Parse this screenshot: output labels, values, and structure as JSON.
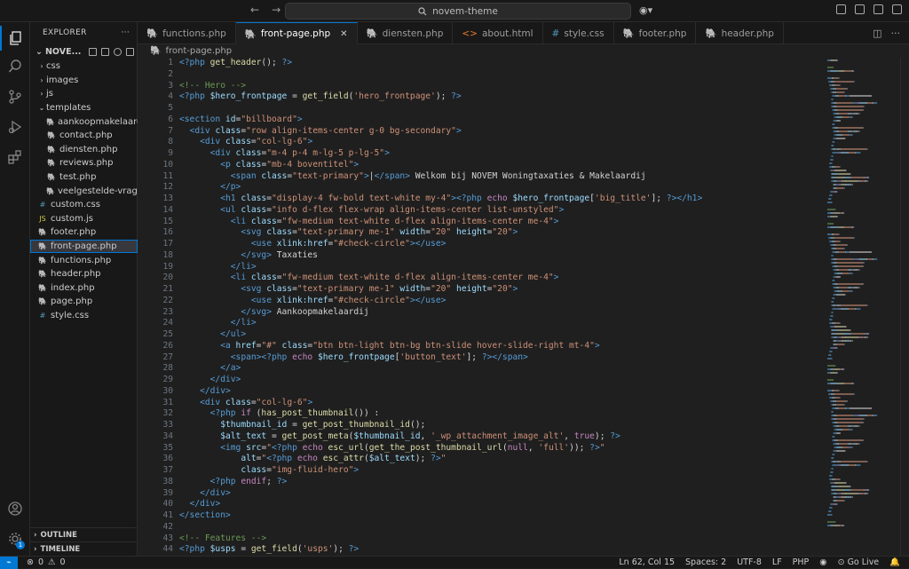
{
  "titlebar": {
    "search": "novem-theme",
    "back": "←",
    "forward": "→"
  },
  "explorer": {
    "title": "EXPLORER",
    "project": "NOVE...",
    "items": [
      {
        "label": "css",
        "type": "folder",
        "depth": 1,
        "open": false
      },
      {
        "label": "images",
        "type": "folder",
        "depth": 1,
        "open": false
      },
      {
        "label": "js",
        "type": "folder",
        "depth": 1,
        "open": false
      },
      {
        "label": "templates",
        "type": "folder",
        "depth": 1,
        "open": true
      },
      {
        "label": "aankoopmakelaard...",
        "type": "php",
        "depth": 2
      },
      {
        "label": "contact.php",
        "type": "php",
        "depth": 2
      },
      {
        "label": "diensten.php",
        "type": "php",
        "depth": 2
      },
      {
        "label": "reviews.php",
        "type": "php",
        "depth": 2
      },
      {
        "label": "test.php",
        "type": "php",
        "depth": 2
      },
      {
        "label": "veelgestelde-vrag...",
        "type": "php",
        "depth": 2
      },
      {
        "label": "custom.css",
        "type": "css",
        "depth": 1
      },
      {
        "label": "custom.js",
        "type": "js",
        "depth": 1
      },
      {
        "label": "footer.php",
        "type": "php",
        "depth": 1
      },
      {
        "label": "front-page.php",
        "type": "php",
        "depth": 1,
        "selected": true
      },
      {
        "label": "functions.php",
        "type": "php",
        "depth": 1
      },
      {
        "label": "header.php",
        "type": "php",
        "depth": 1
      },
      {
        "label": "index.php",
        "type": "php",
        "depth": 1
      },
      {
        "label": "page.php",
        "type": "php",
        "depth": 1
      },
      {
        "label": "style.css",
        "type": "css",
        "depth": 1
      }
    ],
    "outline": "OUTLINE",
    "timeline": "TIMELINE"
  },
  "tabs": [
    {
      "label": "functions.php",
      "type": "php"
    },
    {
      "label": "front-page.php",
      "type": "php",
      "active": true
    },
    {
      "label": "diensten.php",
      "type": "php"
    },
    {
      "label": "about.html",
      "type": "html"
    },
    {
      "label": "style.css",
      "type": "css"
    },
    {
      "label": "footer.php",
      "type": "php"
    },
    {
      "label": "header.php",
      "type": "php"
    }
  ],
  "breadcrumb": "front-page.php",
  "code": [
    [
      [
        "t",
        "<?php "
      ],
      [
        "f",
        "get_header"
      ],
      [
        "p",
        "(); "
      ],
      [
        "t",
        "?>"
      ]
    ],
    [],
    [
      [
        "c",
        "<!-- Hero -->"
      ]
    ],
    [
      [
        "t",
        "<?php "
      ],
      [
        "v",
        "$hero_frontpage"
      ],
      [
        "p",
        " = "
      ],
      [
        "f",
        "get_field"
      ],
      [
        "p",
        "("
      ],
      [
        "s",
        "'hero_frontpage'"
      ],
      [
        "p",
        "); "
      ],
      [
        "t",
        "?>"
      ]
    ],
    [],
    [
      [
        "t",
        "<section "
      ],
      [
        "a",
        "id"
      ],
      [
        "p",
        "="
      ],
      [
        "s",
        "\"billboard\""
      ],
      [
        "t",
        ">"
      ]
    ],
    [
      [
        "p",
        "  "
      ],
      [
        "t",
        "<div "
      ],
      [
        "a",
        "class"
      ],
      [
        "p",
        "="
      ],
      [
        "s",
        "\"row align-items-center g-0 bg-secondary\""
      ],
      [
        "t",
        ">"
      ]
    ],
    [
      [
        "p",
        "    "
      ],
      [
        "t",
        "<div "
      ],
      [
        "a",
        "class"
      ],
      [
        "p",
        "="
      ],
      [
        "s",
        "\"col-lg-6\""
      ],
      [
        "t",
        ">"
      ]
    ],
    [
      [
        "p",
        "      "
      ],
      [
        "t",
        "<div "
      ],
      [
        "a",
        "class"
      ],
      [
        "p",
        "="
      ],
      [
        "s",
        "\"m-4 p-4 m-lg-5 p-lg-5\""
      ],
      [
        "t",
        ">"
      ]
    ],
    [
      [
        "p",
        "        "
      ],
      [
        "t",
        "<p "
      ],
      [
        "a",
        "class"
      ],
      [
        "p",
        "="
      ],
      [
        "s",
        "\"mb-4 boventitel\""
      ],
      [
        "t",
        ">"
      ]
    ],
    [
      [
        "p",
        "          "
      ],
      [
        "t",
        "<span "
      ],
      [
        "a",
        "class"
      ],
      [
        "p",
        "="
      ],
      [
        "s",
        "\"text-primary\""
      ],
      [
        "t",
        ">"
      ],
      [
        "p",
        "|"
      ],
      [
        "t",
        "</span>"
      ],
      [
        "p",
        " Welkom bij NOVEM Woningtaxaties & Makelaardij"
      ]
    ],
    [
      [
        "p",
        "        "
      ],
      [
        "t",
        "</p>"
      ]
    ],
    [
      [
        "p",
        "        "
      ],
      [
        "t",
        "<h1 "
      ],
      [
        "a",
        "class"
      ],
      [
        "p",
        "="
      ],
      [
        "s",
        "\"display-4 fw-bold text-white my-4\""
      ],
      [
        "t",
        ">"
      ],
      [
        "t",
        "<?php "
      ],
      [
        "k",
        "echo "
      ],
      [
        "v",
        "$hero_frontpage"
      ],
      [
        "p",
        "["
      ],
      [
        "s",
        "'big_title'"
      ],
      [
        "p",
        "]; "
      ],
      [
        "t",
        "?>"
      ],
      [
        "t",
        "</h1>"
      ]
    ],
    [
      [
        "p",
        "        "
      ],
      [
        "t",
        "<ul "
      ],
      [
        "a",
        "class"
      ],
      [
        "p",
        "="
      ],
      [
        "s",
        "\"info d-flex flex-wrap align-items-center list-unstyled\""
      ],
      [
        "t",
        ">"
      ]
    ],
    [
      [
        "p",
        "          "
      ],
      [
        "t",
        "<li "
      ],
      [
        "a",
        "class"
      ],
      [
        "p",
        "="
      ],
      [
        "s",
        "\"fw-medium text-white d-flex align-items-center me-4\""
      ],
      [
        "t",
        ">"
      ]
    ],
    [
      [
        "p",
        "            "
      ],
      [
        "t",
        "<svg "
      ],
      [
        "a",
        "class"
      ],
      [
        "p",
        "="
      ],
      [
        "s",
        "\"text-primary me-1\""
      ],
      [
        "a",
        " width"
      ],
      [
        "p",
        "="
      ],
      [
        "s",
        "\"20\""
      ],
      [
        "a",
        " height"
      ],
      [
        "p",
        "="
      ],
      [
        "s",
        "\"20\""
      ],
      [
        "t",
        ">"
      ]
    ],
    [
      [
        "p",
        "              "
      ],
      [
        "t",
        "<use "
      ],
      [
        "a",
        "xlink:href"
      ],
      [
        "p",
        "="
      ],
      [
        "s",
        "\"#check-circle\""
      ],
      [
        "t",
        "></use>"
      ]
    ],
    [
      [
        "p",
        "            "
      ],
      [
        "t",
        "</svg>"
      ],
      [
        "p",
        " Taxaties"
      ]
    ],
    [
      [
        "p",
        "          "
      ],
      [
        "t",
        "</li>"
      ]
    ],
    [
      [
        "p",
        "          "
      ],
      [
        "t",
        "<li "
      ],
      [
        "a",
        "class"
      ],
      [
        "p",
        "="
      ],
      [
        "s",
        "\"fw-medium text-white d-flex align-items-center me-4\""
      ],
      [
        "t",
        ">"
      ]
    ],
    [
      [
        "p",
        "            "
      ],
      [
        "t",
        "<svg "
      ],
      [
        "a",
        "class"
      ],
      [
        "p",
        "="
      ],
      [
        "s",
        "\"text-primary me-1\""
      ],
      [
        "a",
        " width"
      ],
      [
        "p",
        "="
      ],
      [
        "s",
        "\"20\""
      ],
      [
        "a",
        " height"
      ],
      [
        "p",
        "="
      ],
      [
        "s",
        "\"20\""
      ],
      [
        "t",
        ">"
      ]
    ],
    [
      [
        "p",
        "              "
      ],
      [
        "t",
        "<use "
      ],
      [
        "a",
        "xlink:href"
      ],
      [
        "p",
        "="
      ],
      [
        "s",
        "\"#check-circle\""
      ],
      [
        "t",
        "></use>"
      ]
    ],
    [
      [
        "p",
        "            "
      ],
      [
        "t",
        "</svg>"
      ],
      [
        "p",
        " Aankoopmakelaardij"
      ]
    ],
    [
      [
        "p",
        "          "
      ],
      [
        "t",
        "</li>"
      ]
    ],
    [
      [
        "p",
        "        "
      ],
      [
        "t",
        "</ul>"
      ]
    ],
    [
      [
        "p",
        "        "
      ],
      [
        "t",
        "<a "
      ],
      [
        "a",
        "href"
      ],
      [
        "p",
        "="
      ],
      [
        "s",
        "\"#\""
      ],
      [
        "a",
        " class"
      ],
      [
        "p",
        "="
      ],
      [
        "s",
        "\"btn btn-light btn-bg btn-slide hover-slide-right mt-4\""
      ],
      [
        "t",
        ">"
      ]
    ],
    [
      [
        "p",
        "          "
      ],
      [
        "t",
        "<span>"
      ],
      [
        "t",
        "<?php "
      ],
      [
        "k",
        "echo "
      ],
      [
        "v",
        "$hero_frontpage"
      ],
      [
        "p",
        "["
      ],
      [
        "s",
        "'button_text'"
      ],
      [
        "p",
        "]; "
      ],
      [
        "t",
        "?>"
      ],
      [
        "t",
        "</span>"
      ]
    ],
    [
      [
        "p",
        "        "
      ],
      [
        "t",
        "</a>"
      ]
    ],
    [
      [
        "p",
        "      "
      ],
      [
        "t",
        "</div>"
      ]
    ],
    [
      [
        "p",
        "    "
      ],
      [
        "t",
        "</div>"
      ]
    ],
    [
      [
        "p",
        "    "
      ],
      [
        "t",
        "<div "
      ],
      [
        "a",
        "class"
      ],
      [
        "p",
        "="
      ],
      [
        "s",
        "\"col-lg-6\""
      ],
      [
        "t",
        ">"
      ]
    ],
    [
      [
        "p",
        "      "
      ],
      [
        "t",
        "<?php "
      ],
      [
        "k",
        "if "
      ],
      [
        "p",
        "("
      ],
      [
        "f",
        "has_post_thumbnail"
      ],
      [
        "p",
        "()) :"
      ]
    ],
    [
      [
        "p",
        "        "
      ],
      [
        "v",
        "$thumbnail_id"
      ],
      [
        "p",
        " = "
      ],
      [
        "f",
        "get_post_thumbnail_id"
      ],
      [
        "p",
        "();"
      ]
    ],
    [
      [
        "p",
        "        "
      ],
      [
        "v",
        "$alt_text"
      ],
      [
        "p",
        " = "
      ],
      [
        "f",
        "get_post_meta"
      ],
      [
        "p",
        "("
      ],
      [
        "v",
        "$thumbnail_id"
      ],
      [
        "p",
        ", "
      ],
      [
        "s",
        "'_wp_attachment_image_alt'"
      ],
      [
        "p",
        ", "
      ],
      [
        "k",
        "true"
      ],
      [
        "p",
        "); "
      ],
      [
        "t",
        "?>"
      ]
    ],
    [
      [
        "p",
        "        "
      ],
      [
        "t",
        "<img "
      ],
      [
        "a",
        "src"
      ],
      [
        "p",
        "="
      ],
      [
        "s",
        "\""
      ],
      [
        "t",
        "<?php "
      ],
      [
        "k",
        "echo "
      ],
      [
        "f",
        "esc_url"
      ],
      [
        "p",
        "("
      ],
      [
        "f",
        "get_the_post_thumbnail_url"
      ],
      [
        "p",
        "("
      ],
      [
        "k",
        "null"
      ],
      [
        "p",
        ", "
      ],
      [
        "s",
        "'full'"
      ],
      [
        "p",
        ")); "
      ],
      [
        "t",
        "?>"
      ],
      [
        "s",
        "\""
      ]
    ],
    [
      [
        "p",
        "            "
      ],
      [
        "a",
        "alt"
      ],
      [
        "p",
        "="
      ],
      [
        "s",
        "\""
      ],
      [
        "t",
        "<?php "
      ],
      [
        "k",
        "echo "
      ],
      [
        "f",
        "esc_attr"
      ],
      [
        "p",
        "("
      ],
      [
        "v",
        "$alt_text"
      ],
      [
        "p",
        "); "
      ],
      [
        "t",
        "?>"
      ],
      [
        "s",
        "\""
      ]
    ],
    [
      [
        "p",
        "            "
      ],
      [
        "a",
        "class"
      ],
      [
        "p",
        "="
      ],
      [
        "s",
        "\"img-fluid-hero\""
      ],
      [
        "t",
        ">"
      ]
    ],
    [
      [
        "p",
        "      "
      ],
      [
        "t",
        "<?php "
      ],
      [
        "k",
        "endif"
      ],
      [
        "p",
        "; "
      ],
      [
        "t",
        "?>"
      ]
    ],
    [
      [
        "p",
        "    "
      ],
      [
        "t",
        "</div>"
      ]
    ],
    [
      [
        "p",
        "  "
      ],
      [
        "t",
        "</div>"
      ]
    ],
    [
      [
        "t",
        "</section>"
      ]
    ],
    [],
    [
      [
        "c",
        "<!-- Features -->"
      ]
    ],
    [
      [
        "t",
        "<?php "
      ],
      [
        "v",
        "$usps"
      ],
      [
        "p",
        " = "
      ],
      [
        "f",
        "get_field"
      ],
      [
        "p",
        "("
      ],
      [
        "s",
        "'usps'"
      ],
      [
        "p",
        "); "
      ],
      [
        "t",
        "?>"
      ]
    ]
  ],
  "status": {
    "errors": "0",
    "warnings": "0",
    "position": "Ln 62, Col 15",
    "spaces": "Spaces: 2",
    "encoding": "UTF-8",
    "eol": "LF",
    "language": "PHP",
    "golive": "Go Live"
  },
  "colors": {
    "accent": "#0078d4",
    "tag": "#569cd6",
    "attr": "#9cdcfe",
    "string": "#ce9178",
    "func": "#dcdcaa",
    "keyword": "#c586c0",
    "comment": "#6a9955"
  }
}
